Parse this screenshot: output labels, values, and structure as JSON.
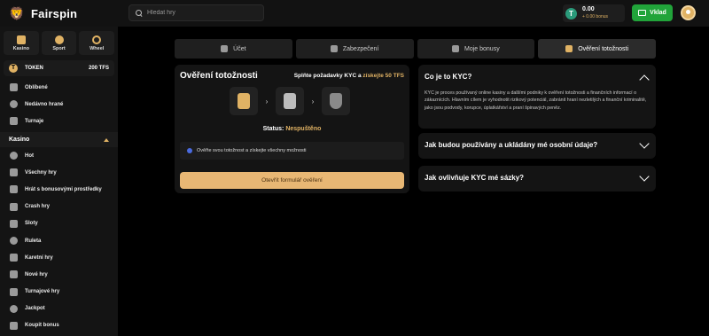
{
  "brand": {
    "name": "Fairspin"
  },
  "search": {
    "placeholder": "Hledat hry"
  },
  "wallet": {
    "currency_icon": "T",
    "amount": "0.00",
    "bonus": "+ 0.00 bonus"
  },
  "header": {
    "deposit_label": "Vklad"
  },
  "sidebar": {
    "categories": [
      {
        "label": "Kasino",
        "icon": "dice-icon"
      },
      {
        "label": "Sport",
        "icon": "ball-icon"
      },
      {
        "label": "Wheel",
        "icon": "wheel-icon"
      }
    ],
    "token": {
      "label": "TOKEN",
      "value": "200 TFS",
      "icon": "T"
    },
    "items": [
      {
        "label": "Oblíbené",
        "icon": "heart-icon"
      },
      {
        "label": "Nedávno hrané",
        "icon": "history-icon"
      },
      {
        "label": "Turnaje",
        "icon": "trophy-icon"
      }
    ],
    "section": {
      "label": "Kasino"
    },
    "casino_items": [
      {
        "label": "Hot",
        "icon": "fire-icon"
      },
      {
        "label": "Všechny hry",
        "icon": "grid-icon"
      },
      {
        "label": "Hrát s bonusovými prostředky",
        "icon": "gift-icon"
      },
      {
        "label": "Crash hry",
        "icon": "rocket-icon"
      },
      {
        "label": "Sloty",
        "icon": "slot-icon"
      },
      {
        "label": "Ruleta",
        "icon": "roulette-icon"
      },
      {
        "label": "Karetní hry",
        "icon": "cards-icon"
      },
      {
        "label": "Nové hry",
        "icon": "new-icon"
      },
      {
        "label": "Turnajové hry",
        "icon": "trophy-icon"
      },
      {
        "label": "Jackpot",
        "icon": "jackpot-icon"
      },
      {
        "label": "Koupit bonus",
        "icon": "cart-icon"
      }
    ]
  },
  "tabs": [
    {
      "label": "Účet",
      "icon": "user-icon"
    },
    {
      "label": "Zabezpečení",
      "icon": "lock-icon"
    },
    {
      "label": "Moje bonusy",
      "icon": "box-icon"
    },
    {
      "label": "Ověření totožnosti",
      "icon": "shield-icon"
    }
  ],
  "verification": {
    "title": "Ověření totožnosti",
    "promo_text": "Splňte požadavky KYC a",
    "promo_reward": "získejte 50 TFS",
    "status_label": "Status:",
    "status_value": "Nespuštěno",
    "info": "Ověřte svou totožnost a získejte všechny možnosti",
    "button": "Otevřít formulář ověření"
  },
  "faq": [
    {
      "question": "Co je to KYC?",
      "answer": "KYC je proces používaný online kasiny a dalšími podniky k ověření totožnosti a finančních informací o zákaznících. Hlavním cílem je vyhodnotit rizikový potenciál, zabránit hraní nezletilých a finanční kriminalitě, jako jsou podvody, korupce, úplatkářství a praní špinavých peněz."
    },
    {
      "question": "Jak budou používány a ukládány mé osobní údaje?"
    },
    {
      "question": "Jak ovlivňuje KYC mé sázky?"
    }
  ],
  "colors": {
    "accent": "#e0b264",
    "deposit": "#21a43a",
    "background": "#000000",
    "panel": "#141414"
  }
}
